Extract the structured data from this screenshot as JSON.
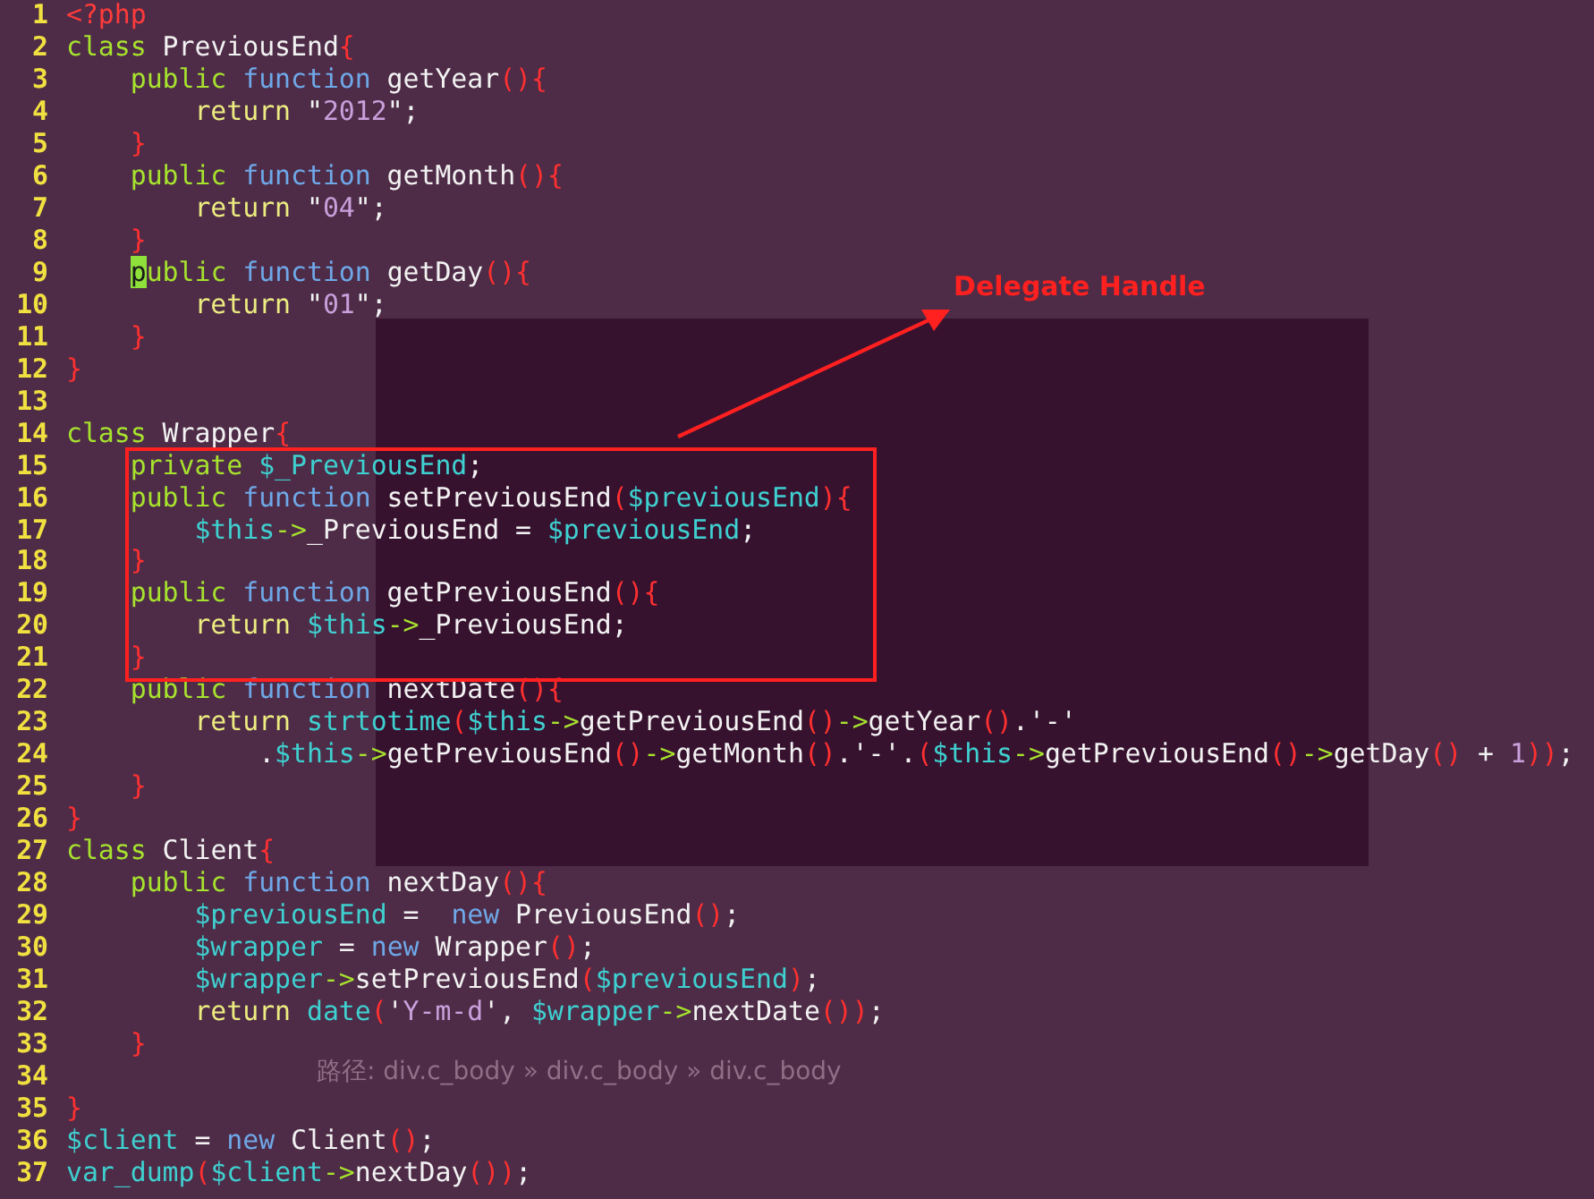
{
  "editor": {
    "lines": [
      {
        "number": "1",
        "tokens": [
          {
            "text": "<?php",
            "kind": "tag"
          }
        ]
      },
      {
        "number": "2",
        "tokens": [
          {
            "text": "class",
            "kind": "keyword"
          },
          {
            "text": " PreviousEnd",
            "kind": "plain"
          },
          {
            "text": "{",
            "kind": "brace"
          }
        ]
      },
      {
        "number": "3",
        "tokens": [
          {
            "text": "    public",
            "kind": "keyword"
          },
          {
            "text": " function",
            "kind": "storage"
          },
          {
            "text": " getYear",
            "kind": "plain"
          },
          {
            "text": "(){",
            "kind": "brace"
          }
        ]
      },
      {
        "number": "4",
        "tokens": [
          {
            "text": "        return",
            "kind": "control"
          },
          {
            "text": " \"",
            "kind": "plain"
          },
          {
            "text": "2012",
            "kind": "string"
          },
          {
            "text": "\";",
            "kind": "plain"
          }
        ]
      },
      {
        "number": "5",
        "tokens": [
          {
            "text": "    }",
            "kind": "brace"
          }
        ]
      },
      {
        "number": "6",
        "tokens": [
          {
            "text": "    public",
            "kind": "keyword"
          },
          {
            "text": " function",
            "kind": "storage"
          },
          {
            "text": " getMonth",
            "kind": "plain"
          },
          {
            "text": "(){",
            "kind": "brace"
          }
        ]
      },
      {
        "number": "7",
        "tokens": [
          {
            "text": "        return",
            "kind": "control"
          },
          {
            "text": " \"",
            "kind": "plain"
          },
          {
            "text": "04",
            "kind": "string"
          },
          {
            "text": "\";",
            "kind": "plain"
          }
        ]
      },
      {
        "number": "8",
        "tokens": [
          {
            "text": "    }",
            "kind": "brace"
          }
        ]
      },
      {
        "number": "9",
        "tokens": [
          {
            "text": "    p",
            "kind": "cursor"
          },
          {
            "text": "ublic",
            "kind": "keyword"
          },
          {
            "text": " function",
            "kind": "storage"
          },
          {
            "text": " getDay",
            "kind": "plain"
          },
          {
            "text": "(){",
            "kind": "brace"
          }
        ]
      },
      {
        "number": "10",
        "tokens": [
          {
            "text": "        return",
            "kind": "control"
          },
          {
            "text": " \"",
            "kind": "plain"
          },
          {
            "text": "01",
            "kind": "string"
          },
          {
            "text": "\";",
            "kind": "plain"
          }
        ]
      },
      {
        "number": "11",
        "tokens": [
          {
            "text": "    }",
            "kind": "brace"
          }
        ]
      },
      {
        "number": "12",
        "tokens": [
          {
            "text": "}",
            "kind": "brace"
          }
        ]
      },
      {
        "number": "13"
      },
      {
        "number": "14",
        "tokens": [
          {
            "text": "class",
            "kind": "keyword"
          },
          {
            "text": " Wrapper",
            "kind": "plain"
          },
          {
            "text": "{",
            "kind": "brace"
          }
        ]
      },
      {
        "number": "15",
        "tokens": [
          {
            "text": "    private",
            "kind": "keyword"
          },
          {
            "text": " $_PreviousEnd",
            "kind": "variable"
          },
          {
            "text": ";",
            "kind": "plain"
          }
        ]
      },
      {
        "number": "16",
        "tokens": [
          {
            "text": "    public",
            "kind": "keyword"
          },
          {
            "text": " function",
            "kind": "storage"
          },
          {
            "text": " setPreviousEnd",
            "kind": "plain"
          },
          {
            "text": "(",
            "kind": "brace"
          },
          {
            "text": "$previousEnd",
            "kind": "variable"
          },
          {
            "text": "){",
            "kind": "brace"
          }
        ]
      },
      {
        "number": "17",
        "tokens": [
          {
            "text": "        $this",
            "kind": "variable"
          },
          {
            "text": "->",
            "kind": "operator"
          },
          {
            "text": "_PreviousEnd = ",
            "kind": "plain"
          },
          {
            "text": "$previousEnd",
            "kind": "variable"
          },
          {
            "text": ";",
            "kind": "plain"
          }
        ]
      },
      {
        "number": "18",
        "tokens": [
          {
            "text": "    }",
            "kind": "brace"
          }
        ]
      },
      {
        "number": "19",
        "tokens": [
          {
            "text": "    public",
            "kind": "keyword"
          },
          {
            "text": " function",
            "kind": "storage"
          },
          {
            "text": " getPreviousEnd",
            "kind": "plain"
          },
          {
            "text": "(){",
            "kind": "brace"
          }
        ]
      },
      {
        "number": "20",
        "tokens": [
          {
            "text": "        return",
            "kind": "control"
          },
          {
            "text": " $this",
            "kind": "variable"
          },
          {
            "text": "->",
            "kind": "operator"
          },
          {
            "text": "_PreviousEnd;",
            "kind": "plain"
          }
        ]
      },
      {
        "number": "21",
        "tokens": [
          {
            "text": "    }",
            "kind": "brace"
          }
        ]
      },
      {
        "number": "22",
        "tokens": [
          {
            "text": "    public",
            "kind": "keyword"
          },
          {
            "text": " function",
            "kind": "storage"
          },
          {
            "text": " nextDate",
            "kind": "plain"
          },
          {
            "text": "(){",
            "kind": "brace"
          }
        ]
      },
      {
        "number": "23",
        "tokens": [
          {
            "text": "        return",
            "kind": "control"
          },
          {
            "text": " strtotime",
            "kind": "builtin"
          },
          {
            "text": "(",
            "kind": "brace"
          },
          {
            "text": "$this",
            "kind": "variable"
          },
          {
            "text": "->",
            "kind": "operator"
          },
          {
            "text": "getPreviousEnd",
            "kind": "plain"
          },
          {
            "text": "()",
            "kind": "brace"
          },
          {
            "text": "->",
            "kind": "operator"
          },
          {
            "text": "getYear",
            "kind": "plain"
          },
          {
            "text": "()",
            "kind": "brace"
          },
          {
            "text": ".'-'",
            "kind": "plain"
          }
        ]
      },
      {
        "number": "24",
        "tokens": [
          {
            "text": "            .",
            "kind": "plain"
          },
          {
            "text": "$this",
            "kind": "variable"
          },
          {
            "text": "->",
            "kind": "operator"
          },
          {
            "text": "getPreviousEnd",
            "kind": "plain"
          },
          {
            "text": "()",
            "kind": "brace"
          },
          {
            "text": "->",
            "kind": "operator"
          },
          {
            "text": "getMonth",
            "kind": "plain"
          },
          {
            "text": "()",
            "kind": "brace"
          },
          {
            "text": ".'-'.",
            "kind": "plain"
          },
          {
            "text": "(",
            "kind": "brace"
          },
          {
            "text": "$this",
            "kind": "variable"
          },
          {
            "text": "->",
            "kind": "operator"
          },
          {
            "text": "getPreviousEnd",
            "kind": "plain"
          },
          {
            "text": "()",
            "kind": "brace"
          },
          {
            "text": "->",
            "kind": "operator"
          },
          {
            "text": "getDay",
            "kind": "plain"
          },
          {
            "text": "()",
            "kind": "brace"
          },
          {
            "text": " + ",
            "kind": "plain"
          },
          {
            "text": "1",
            "kind": "number"
          },
          {
            "text": "))",
            "kind": "brace"
          },
          {
            "text": ";",
            "kind": "plain"
          }
        ]
      },
      {
        "number": "25",
        "tokens": [
          {
            "text": "    }",
            "kind": "brace"
          }
        ]
      },
      {
        "number": "26",
        "tokens": [
          {
            "text": "}",
            "kind": "brace"
          }
        ]
      },
      {
        "number": "27",
        "tokens": [
          {
            "text": "class",
            "kind": "keyword"
          },
          {
            "text": " Client",
            "kind": "plain"
          },
          {
            "text": "{",
            "kind": "brace"
          }
        ]
      },
      {
        "number": "28",
        "tokens": [
          {
            "text": "    public",
            "kind": "keyword"
          },
          {
            "text": " function",
            "kind": "storage"
          },
          {
            "text": " nextDay",
            "kind": "plain"
          },
          {
            "text": "(){",
            "kind": "brace"
          }
        ]
      },
      {
        "number": "29",
        "tokens": [
          {
            "text": "        $previousEnd",
            "kind": "variable"
          },
          {
            "text": " =  ",
            "kind": "plain"
          },
          {
            "text": "new",
            "kind": "storage"
          },
          {
            "text": " PreviousEnd",
            "kind": "plain"
          },
          {
            "text": "()",
            "kind": "brace"
          },
          {
            "text": ";",
            "kind": "plain"
          }
        ]
      },
      {
        "number": "30",
        "tokens": [
          {
            "text": "        $wrapper",
            "kind": "variable"
          },
          {
            "text": " = ",
            "kind": "plain"
          },
          {
            "text": "new",
            "kind": "storage"
          },
          {
            "text": " Wrapper",
            "kind": "plain"
          },
          {
            "text": "()",
            "kind": "brace"
          },
          {
            "text": ";",
            "kind": "plain"
          }
        ]
      },
      {
        "number": "31",
        "tokens": [
          {
            "text": "        $wrapper",
            "kind": "variable"
          },
          {
            "text": "->",
            "kind": "operator"
          },
          {
            "text": "setPreviousEnd",
            "kind": "plain"
          },
          {
            "text": "(",
            "kind": "brace"
          },
          {
            "text": "$previousEnd",
            "kind": "variable"
          },
          {
            "text": ")",
            "kind": "brace"
          },
          {
            "text": ";",
            "kind": "plain"
          }
        ]
      },
      {
        "number": "32",
        "tokens": [
          {
            "text": "        return",
            "kind": "control"
          },
          {
            "text": " date",
            "kind": "builtin"
          },
          {
            "text": "(",
            "kind": "brace"
          },
          {
            "text": "'",
            "kind": "plain"
          },
          {
            "text": "Y-m-d",
            "kind": "string"
          },
          {
            "text": "', ",
            "kind": "plain"
          },
          {
            "text": "$wrapper",
            "kind": "variable"
          },
          {
            "text": "->",
            "kind": "operator"
          },
          {
            "text": "nextDate",
            "kind": "plain"
          },
          {
            "text": "())",
            "kind": "brace"
          },
          {
            "text": ";",
            "kind": "plain"
          }
        ]
      },
      {
        "number": "33",
        "tokens": [
          {
            "text": "    }",
            "kind": "brace"
          }
        ]
      },
      {
        "number": "34"
      },
      {
        "number": "35",
        "tokens": [
          {
            "text": "}",
            "kind": "brace"
          }
        ]
      },
      {
        "number": "36",
        "tokens": [
          {
            "text": "$client",
            "kind": "variable"
          },
          {
            "text": " = ",
            "kind": "plain"
          },
          {
            "text": "new",
            "kind": "storage"
          },
          {
            "text": " Client",
            "kind": "plain"
          },
          {
            "text": "()",
            "kind": "brace"
          },
          {
            "text": ";",
            "kind": "plain"
          }
        ]
      },
      {
        "number": "37",
        "tokens": [
          {
            "text": "var_dump",
            "kind": "builtin"
          },
          {
            "text": "(",
            "kind": "brace"
          },
          {
            "text": "$client",
            "kind": "variable"
          },
          {
            "text": "->",
            "kind": "operator"
          },
          {
            "text": "nextDay",
            "kind": "plain"
          },
          {
            "text": "())",
            "kind": "brace"
          },
          {
            "text": ";",
            "kind": "plain"
          }
        ]
      }
    ]
  },
  "annotation": {
    "label": "Delegate Handle"
  },
  "background_page": {
    "path_bar": "路径: div.c_body » div.c_body » div.c_body"
  }
}
